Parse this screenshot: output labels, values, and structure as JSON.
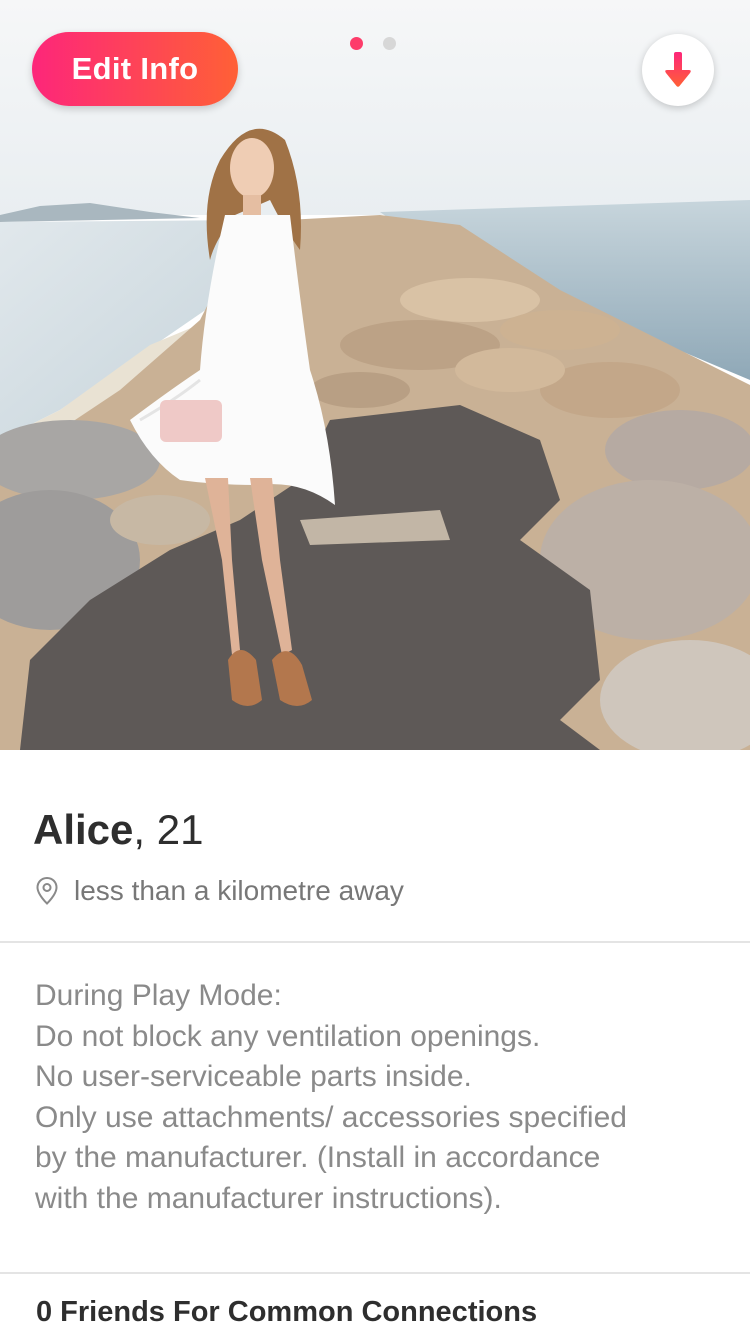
{
  "header": {
    "edit_button_label": "Edit Info",
    "photo_indicator": {
      "count": 2,
      "active_index": 0
    },
    "collapse_icon": "arrow-down-icon"
  },
  "photo": {
    "description": "woman-in-white-dress-on-rocky-jetty"
  },
  "profile": {
    "name": "Alice",
    "age": ", 21",
    "distance": "less than a kilometre away",
    "distance_icon": "location-pin-icon"
  },
  "bio": {
    "lines": [
      "During Play Mode:",
      "Do not block any ventilation openings.",
      "No user-serviceable parts inside.",
      "Only use attachments/ accessories specified",
      "by the manufacturer. (Install in accordance",
      "with the manufacturer instructions)."
    ]
  },
  "connections": {
    "title": "0 Friends For Common Connections"
  },
  "colors": {
    "accent_start": "#fd267a",
    "accent_end": "#ff6036",
    "active_dot": "#fd3c6a",
    "inactive_dot": "#d7d7d7"
  }
}
